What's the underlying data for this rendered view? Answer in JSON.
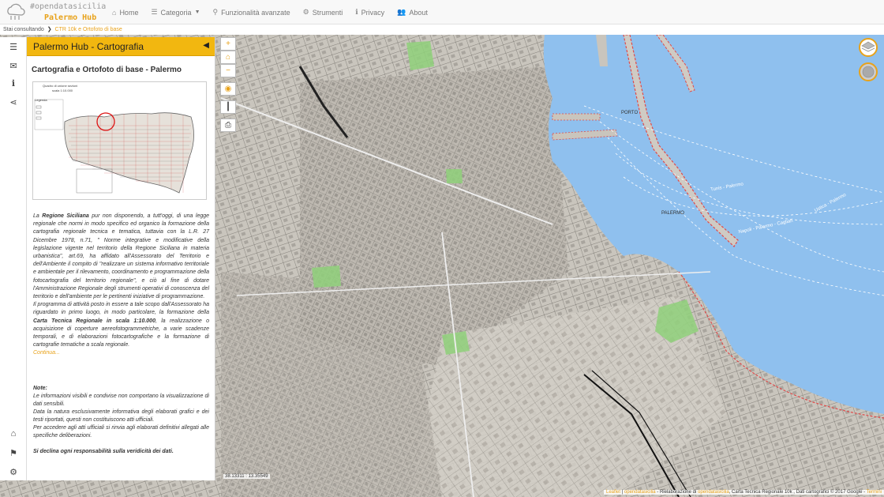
{
  "app": {
    "logo_line1": "#opendatasicilia",
    "logo_line2": "Palermo Hub"
  },
  "nav": {
    "items": [
      {
        "label": "Home",
        "icon": "home-icon"
      },
      {
        "label": "Categoria",
        "icon": "list-icon",
        "dropdown": true
      },
      {
        "label": "Funzionalità avanzate",
        "icon": "search-icon"
      },
      {
        "label": "Strumenti",
        "icon": "gear-icon"
      },
      {
        "label": "Privacy",
        "icon": "info-icon"
      },
      {
        "label": "About",
        "icon": "users-icon"
      }
    ]
  },
  "breadcrumb": {
    "prefix": "Stai consultando",
    "current": "CTR 10k e Ortofoto di base"
  },
  "panel": {
    "title": "Palermo Hub - Cartografia",
    "subtitle": "Cartografia e Ortofoto di base - Palermo",
    "thumbnail": {
      "caption1": "Quadro di unione sezioni",
      "caption2": "scala 1:10.000",
      "legend": "Legenda"
    },
    "body": {
      "p1a": "La ",
      "p1b": "Regione Siciliana",
      "p1c": " pur non disponendo, a tutt'oggi, di una legge regionale che normi in modo specifico ed organico la formazione della cartografia regionale tecnica e tematica, tuttavia con la L.R. 27 Dicembre 1978, n.71, \" Norme integrative e modificative della legislazione vigente nel territorio della Regione Siciliana in materia urbanistica\", art.69, ha affidato all'Assessorato del Territorio e dell'Ambiente il compito di \"realizzare un sistema informativo territoriale e ambientale per il rilevamento, coordinamento e programmazione della fotocartografia del territorio regionale\", e ciò al fine di dotare l'Amministrazione Regionale degli strumenti operativi di conoscenza del territorio e dell'ambiente per le pertinenti iniziative di programmazione.",
      "p2a": "Il programma di attività posto in essere a tale scopo dall'Assessorato ha riguardato in primo luogo, in modo particolare, la formazione della ",
      "p2b": "Carta Tecnica Regionale in scala 1:10.000",
      "p2c": ", la realizzazione o acquisizione di coperture aereofotogrammetriche, a varie scadenze temporali, e di elaborazioni fotocartografiche e la formazione di cartografie tematiche a scala regionale.",
      "continue": "Continua..."
    },
    "note": {
      "title": "Note:",
      "l1": "Le informazioni visibili e condivise non comportano la visualizzazione di dati sensibili.",
      "l2": "Data la natura esclusivamente informativa degli elaborati grafici e dei testi riportati, questi non costituiscono atti ufficiali.",
      "l3": "Per accedere agli atti ufficiali si rinvia agli elaborati definitivi allegati alle specifiche deliberazioni.",
      "l4": "Si declina ogni responsabilità sulla veridicità dei dati."
    }
  },
  "map": {
    "coords": "38.13311 : 13.35549",
    "attribution_a": "Leaflet",
    "attribution_b": " | ",
    "attribution_c": "opendatasicilia",
    "attribution_d": " - Rielaborazione di ",
    "attribution_e": "opendatasicilia",
    "attribution_f": ", Carta Tecnica Regionale 10k , Dati cartografici © 2017 Google - ",
    "attribution_g": "Termini",
    "labels": {
      "porto": "PORTO",
      "palermo": "PALERMO",
      "cagliari": "Napoli - Palermo - Cagliari",
      "ustica": "Ustica - Palermo",
      "tunis": "Tunis - Palermo"
    }
  },
  "colors": {
    "accent": "#f2b710",
    "sea": "#8fc0ee",
    "link": "#e8a21a"
  }
}
